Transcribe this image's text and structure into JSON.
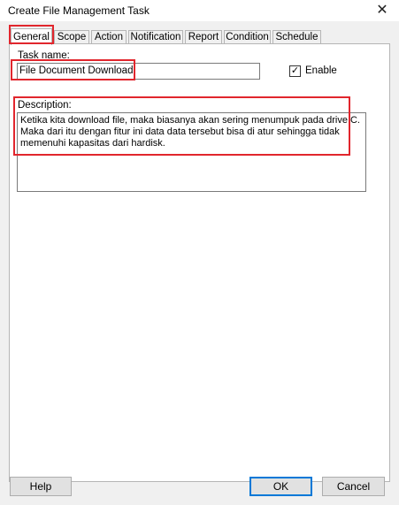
{
  "window": {
    "title": "Create File Management Task",
    "close_glyph": "✕"
  },
  "tabs": [
    {
      "label": "General",
      "active": true
    },
    {
      "label": "Scope"
    },
    {
      "label": "Action"
    },
    {
      "label": "Notification"
    },
    {
      "label": "Report"
    },
    {
      "label": "Condition"
    },
    {
      "label": "Schedule"
    }
  ],
  "general": {
    "task_name_label": "Task name:",
    "task_name_value": "File Document Download",
    "enable_label": "Enable",
    "enable_checked": true,
    "check_glyph": "✓",
    "description_label": "Description:",
    "description_value": "Ketika kita download file, maka biasanya akan sering menumpuk pada drive C.\nMaka dari itu dengan fitur ini data data tersebut bisa di atur sehingga tidak\nmemenuhi kapasitas dari hardisk."
  },
  "buttons": {
    "help": "Help",
    "ok": "OK",
    "cancel": "Cancel"
  },
  "colors": {
    "highlight": "#e1262d",
    "default_button_border": "#0078d7"
  }
}
